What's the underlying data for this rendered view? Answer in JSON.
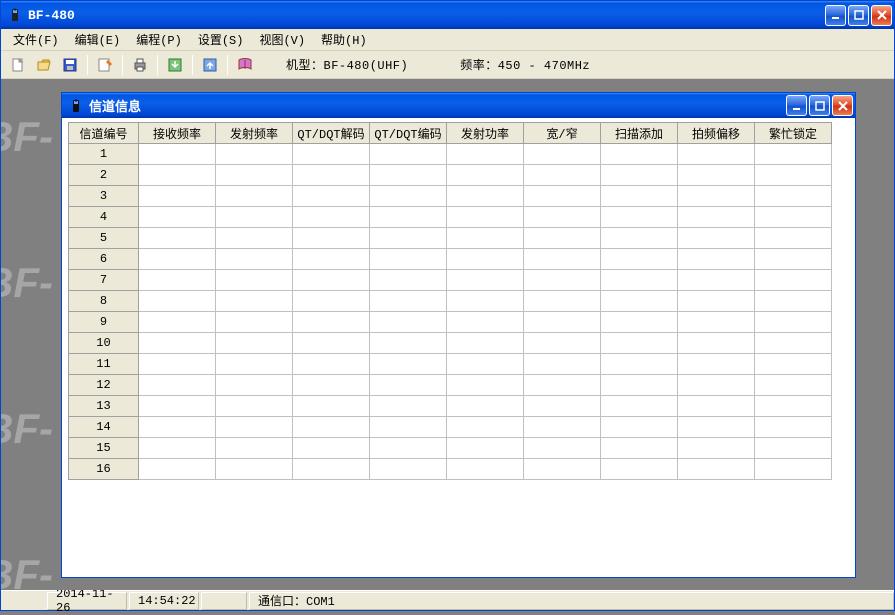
{
  "window": {
    "title": "BF-480"
  },
  "menu": {
    "file": "文件(F)",
    "edit": "编辑(E)",
    "program": "编程(P)",
    "settings": "设置(S)",
    "view": "视图(V)",
    "help": "帮助(H)"
  },
  "toolbar": {
    "model_label": "机型：BF-480(UHF)",
    "freq_label": "频率：450 - 470MHz"
  },
  "child": {
    "title": "信道信息"
  },
  "grid": {
    "corner": "信道编号",
    "columns": [
      "接收频率",
      "发射频率",
      "QT/DQT解码",
      "QT/DQT编码",
      "发射功率",
      "宽/窄",
      "扫描添加",
      "拍频偏移",
      "繁忙锁定"
    ],
    "rows": [
      "1",
      "2",
      "3",
      "4",
      "5",
      "6",
      "7",
      "8",
      "9",
      "10",
      "11",
      "12",
      "13",
      "14",
      "15",
      "16"
    ]
  },
  "status": {
    "date": "2014-11-26",
    "time": "14:54:22",
    "port": "通信口：COM1"
  },
  "watermark_text": "BF-"
}
